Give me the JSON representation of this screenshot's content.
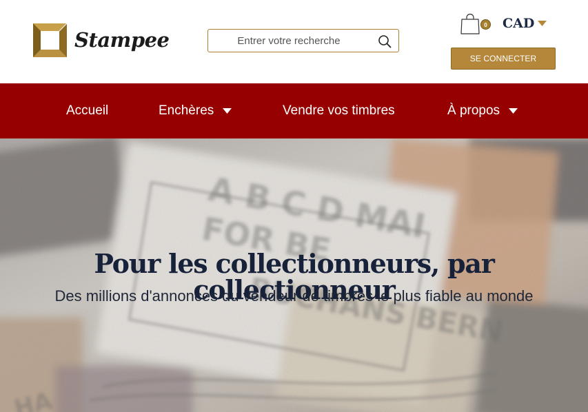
{
  "brand": {
    "name": "Stampee",
    "colors": {
      "gold": "#a6822e",
      "burgundy": "#970000",
      "navy": "#17223a"
    }
  },
  "search": {
    "placeholder": "Entrer votre recherche",
    "icon": "search-icon"
  },
  "cart": {
    "icon": "shopping-bag-icon",
    "count": "0"
  },
  "currency": {
    "label": "CAD",
    "icon": "caret-down-icon"
  },
  "login": {
    "label": "SE CONNECTER"
  },
  "nav": {
    "items": [
      {
        "label": "Accueil",
        "has_dropdown": false
      },
      {
        "label": "Enchères",
        "has_dropdown": true
      },
      {
        "label": "Vendre vos timbres",
        "has_dropdown": false
      },
      {
        "label": "À propos",
        "has_dropdown": true
      }
    ]
  },
  "hero": {
    "title": "Pour les collectionneurs, par collectionneur",
    "subtitle": "Des millions d'annonces du vendeur de timbres le plus fiable au monde"
  }
}
